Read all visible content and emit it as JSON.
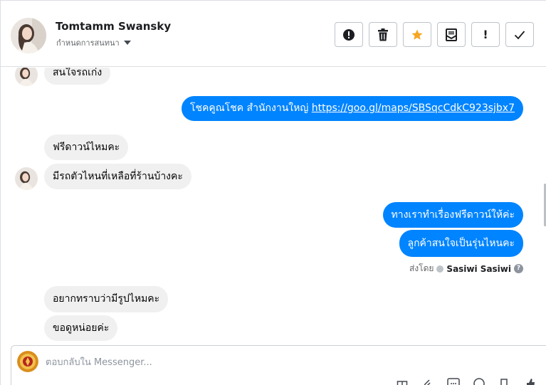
{
  "header": {
    "contact_name": "Tomtamm Swansky",
    "subtitle": "กำหนดการสนทนา",
    "actions": [
      {
        "icon": "alert-circle-icon"
      },
      {
        "icon": "trash-icon"
      },
      {
        "icon": "star-icon"
      },
      {
        "icon": "archive-icon"
      },
      {
        "icon": "exclamation-icon",
        "glyph": "!"
      },
      {
        "icon": "checkmark-icon"
      }
    ]
  },
  "messages": {
    "m1": "สนใจรถเก่ง",
    "m2_prefix": "โชคคูณโชค สำนักงานใหญ่ ",
    "m2_link": "https://goo.gl/maps/SBSqcCdkC923sjbx7",
    "m3": "ฟรีดาวน์ไหมคะ",
    "m4": "มีรถตัวไหนที่เหลือที่ร้านบ้างคะ",
    "m5": "ทางเราทำเรื่องฟรีดาวน์ให้ค่ะ",
    "m6": "ลูกค้าสนใจเป็นรุ่นไหนคะ",
    "m7": "อยากทราบว่ามีรูปไหมคะ",
    "m8": "ขอดูหน่อยค่ะ"
  },
  "sent_by": {
    "label": "ส่งโดย",
    "name": "Sasiwi Sasiwi",
    "help": "?"
  },
  "composer": {
    "placeholder": "ตอบกลับใน Messenger..."
  },
  "colors": {
    "outgoing_bubble": "#0084ff",
    "incoming_bubble": "#f0f0f0",
    "star": "#f5a623"
  }
}
